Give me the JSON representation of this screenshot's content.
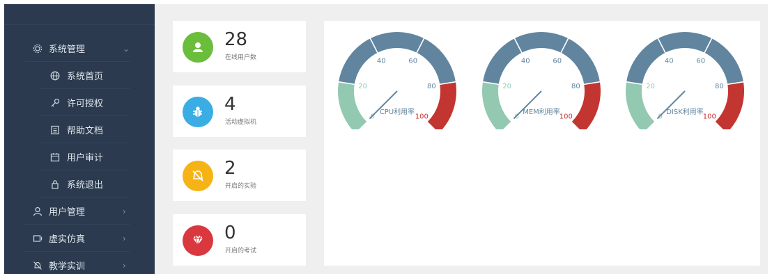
{
  "sidebar": {
    "items": [
      {
        "label": "系统管理",
        "icon": "gear-icon",
        "type": "top",
        "chevron": "⌄"
      },
      {
        "label": "系统首页",
        "icon": "globe-icon",
        "type": "sub"
      },
      {
        "label": "许可授权",
        "icon": "key-icon",
        "type": "sub"
      },
      {
        "label": "帮助文档",
        "icon": "document-icon",
        "type": "sub"
      },
      {
        "label": "用户审计",
        "icon": "calendar-icon",
        "type": "sub"
      },
      {
        "label": "系统退出",
        "icon": "lock-icon",
        "type": "sub"
      },
      {
        "label": "用户管理",
        "icon": "user-icon",
        "type": "top",
        "chevron": "›"
      },
      {
        "label": "虚实仿真",
        "icon": "monitor-icon",
        "type": "top",
        "chevron": "›"
      },
      {
        "label": "教学实训",
        "icon": "bell-off-icon",
        "type": "top",
        "chevron": "›"
      }
    ]
  },
  "stats": [
    {
      "value": "28",
      "label": "在线用户数",
      "color": "#6bbd3c",
      "icon": "user-icon"
    },
    {
      "value": "4",
      "label": "活动虚拟机",
      "color": "#3aaee4",
      "icon": "bug-icon"
    },
    {
      "value": "2",
      "label": "开启的实验",
      "color": "#f6b316",
      "icon": "bell-slash-icon"
    },
    {
      "value": "0",
      "label": "开启的考试",
      "color": "#d9383e",
      "icon": "diamond-icon"
    }
  ],
  "gauges": [
    {
      "label": "CPU利用率",
      "value": 0
    },
    {
      "label": "MEM利用率",
      "value": 0
    },
    {
      "label": "DISK利用率",
      "value": 0
    }
  ],
  "gauge_scale": {
    "ticks": [
      "0",
      "20",
      "40",
      "60",
      "80",
      "100"
    ],
    "min": 0,
    "max": 100,
    "bands": [
      {
        "from": 0,
        "to": 20,
        "color": "#93c9b1"
      },
      {
        "from": 20,
        "to": 80,
        "color": "#62859f"
      },
      {
        "from": 80,
        "to": 100,
        "color": "#c23531"
      }
    ]
  },
  "colors": {
    "sidebar_bg": "#2b3a4e",
    "page_bg": "#efefef"
  }
}
